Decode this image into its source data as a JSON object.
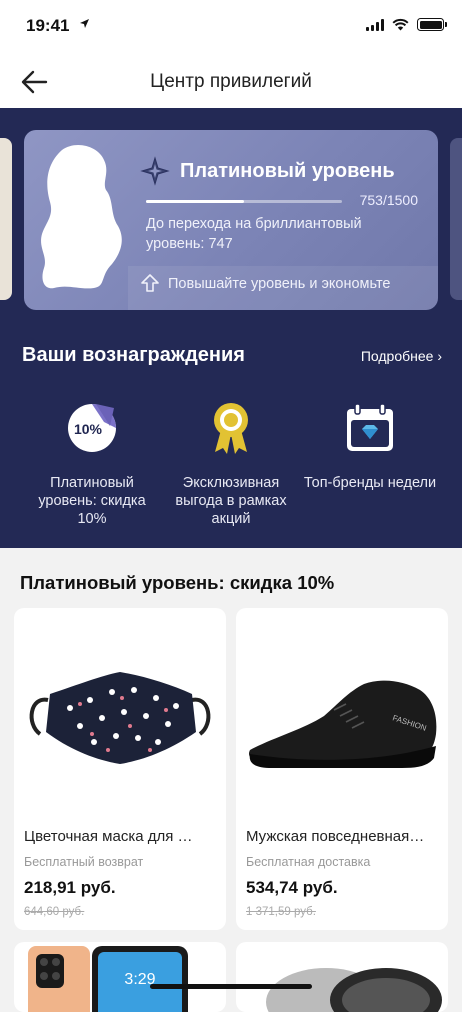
{
  "status": {
    "time": "19:41"
  },
  "nav": {
    "title": "Центр привилегий"
  },
  "level": {
    "title": "Платиновый уровень",
    "progress_text": "753/1500",
    "progress_fraction": 0.502,
    "next_level": "До перехода на бриллиантовый уровень: 747",
    "tip": "Повышайте уровень и экономьте"
  },
  "rewards": {
    "title": "Ваши вознаграждения",
    "more": "Подробнее ›",
    "items": [
      {
        "icon": "discount-badge-icon",
        "badge": "10%",
        "label": "Платиновый уровень: скидка 10%"
      },
      {
        "icon": "medal-icon",
        "label": "Эксклюзивная выгода в рамках акций"
      },
      {
        "icon": "calendar-diamond-icon",
        "label": "Топ-бренды недели"
      }
    ]
  },
  "section": {
    "title": "Платиновый уровень: скидка 10%"
  },
  "products": [
    {
      "name": "Цветочная маска для …",
      "shipping": "Бесплатный возврат",
      "price": "218,91 руб.",
      "old_price": "644,60 руб."
    },
    {
      "name": "Мужская повседневная …",
      "shipping": "Бесплатная доставка",
      "price": "534,74 руб.",
      "old_price": "1 371,59 руб."
    }
  ],
  "product_shoe_brand": "FASHION",
  "phone_time": "3:29",
  "colors": {
    "hero_bg": "#232955",
    "card_bg": "#8088b8",
    "accent_gold": "#e2c233"
  }
}
